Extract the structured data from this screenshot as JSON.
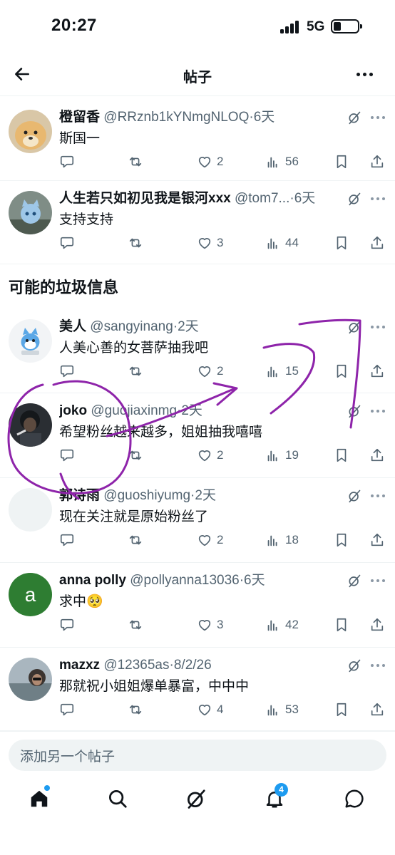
{
  "status_bar": {
    "time": "20:27",
    "network": "5G"
  },
  "header": {
    "title": "帖子"
  },
  "section_title": "可能的垃圾信息",
  "posts": [
    {
      "name": "橙留香",
      "handle": "@RRznb1kYNmgNLOQ",
      "time": "6天",
      "text": "斯国一",
      "likes": "2",
      "views": "56",
      "avatar": "dog-photo"
    },
    {
      "name": "人生若只如初见我是银河xxx",
      "handle": "@tom7...",
      "time": "6天",
      "text": "支持支持",
      "likes": "3",
      "views": "44",
      "avatar": "blue-cat-illustration"
    },
    {
      "name": "美人",
      "handle": "@sangyinang",
      "time": "2天",
      "text": "人美心善的女菩萨抽我吧",
      "likes": "2",
      "views": "15",
      "avatar": "cartoon-blue-cat"
    },
    {
      "name": "joko",
      "handle": "@guojiaxinmg",
      "time": "2天",
      "text": "希望粉丝越来越多，姐姐抽我嘻嘻",
      "likes": "2",
      "views": "19",
      "avatar": "dark-photo"
    },
    {
      "name": "郭诗雨",
      "handle": "@guoshiyumg",
      "time": "2天",
      "text": "现在关注就是原始粉丝了",
      "likes": "2",
      "views": "18",
      "avatar": "blank"
    },
    {
      "name": "anna polly",
      "handle": "@pollyanna13036",
      "time": "6天",
      "text": "求中🥺",
      "likes": "3",
      "views": "42",
      "avatar": "letter",
      "avatar_letter": "a"
    },
    {
      "name": "mazxz",
      "handle": "@12365as",
      "time": "8/2/26",
      "text": "那就祝小姐姐爆单暴富，中中中",
      "likes": "4",
      "views": "53",
      "avatar": "outdoor-photo"
    }
  ],
  "compose": {
    "placeholder": "添加另一个帖子"
  },
  "bottom_nav": {
    "items": [
      "home-icon",
      "search-icon",
      "grok-icon",
      "notifications-icon",
      "messages-icon"
    ],
    "notifications_badge": "4"
  },
  "colors": {
    "accent": "#1d9bf0",
    "muted": "#536471",
    "divider": "#eff3f4",
    "scribble": "#8e24aa",
    "avatar_green": "#2e7d32"
  }
}
